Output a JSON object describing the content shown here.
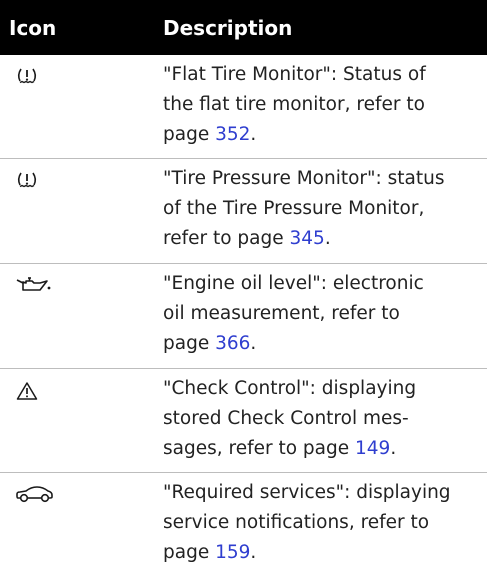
{
  "header": {
    "icon_label": "Icon",
    "description_label": "Description"
  },
  "rows": [
    {
      "icon": "flat-tire-icon",
      "lines": [
        "\"Flat Tire Monitor\": Status of",
        "the flat tire monitor, refer to"
      ],
      "pre": "page ",
      "page": "352",
      "post": "."
    },
    {
      "icon": "tire-pressure-icon",
      "lines": [
        "\"Tire Pressure Monitor\": status",
        "of the Tire Pressure Monitor,"
      ],
      "pre": "refer to page ",
      "page": "345",
      "post": "."
    },
    {
      "icon": "oil-can-icon",
      "lines": [
        "\"Engine oil level\": electronic",
        "oil measurement, refer to"
      ],
      "pre": "page ",
      "page": "366",
      "post": "."
    },
    {
      "icon": "warning-triangle-icon",
      "lines": [
        "\"Check Control\": displaying",
        "stored Check Control mes-"
      ],
      "pre": "sages, refer to page ",
      "page": "149",
      "post": "."
    },
    {
      "icon": "car-icon",
      "lines": [
        "\"Required services\": displaying",
        "service notifications, refer to"
      ],
      "pre": "page ",
      "page": "159",
      "post": "."
    }
  ]
}
